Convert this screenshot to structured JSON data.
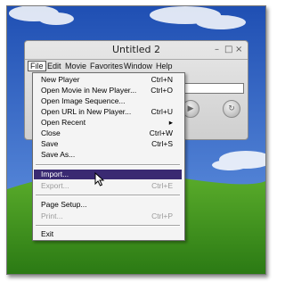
{
  "colors": {
    "sky": "#2f63c3",
    "grass": "#3c8f1e",
    "highlight": "#3a2a72"
  },
  "window": {
    "title": "Untitled 2",
    "controls": [
      "–",
      "□",
      "×"
    ]
  },
  "menubar": [
    "File",
    "Edit",
    "Movie",
    "Favorites",
    "Window",
    "Help"
  ],
  "file_menu": [
    {
      "label": "New Player",
      "shortcut": "Ctrl+N",
      "state": "normal"
    },
    {
      "label": "Open Movie in New Player...",
      "shortcut": "Ctrl+O",
      "state": "normal"
    },
    {
      "label": "Open Image Sequence...",
      "shortcut": "",
      "state": "normal"
    },
    {
      "label": "Open URL in New Player...",
      "shortcut": "Ctrl+U",
      "state": "normal"
    },
    {
      "label": "Open Recent",
      "shortcut": "▸",
      "state": "normal"
    },
    {
      "label": "Close",
      "shortcut": "Ctrl+W",
      "state": "normal"
    },
    {
      "label": "Save",
      "shortcut": "Ctrl+S",
      "state": "normal"
    },
    {
      "label": "Save As...",
      "shortcut": "",
      "state": "normal"
    },
    {
      "label": "Import...",
      "shortcut": "",
      "state": "highlighted"
    },
    {
      "label": "Export...",
      "shortcut": "Ctrl+E",
      "state": "disabled"
    },
    {
      "label": "Page Setup...",
      "shortcut": "",
      "state": "normal"
    },
    {
      "label": "Print...",
      "shortcut": "Ctrl+P",
      "state": "disabled"
    },
    {
      "label": "Exit",
      "shortcut": "",
      "state": "normal"
    }
  ]
}
